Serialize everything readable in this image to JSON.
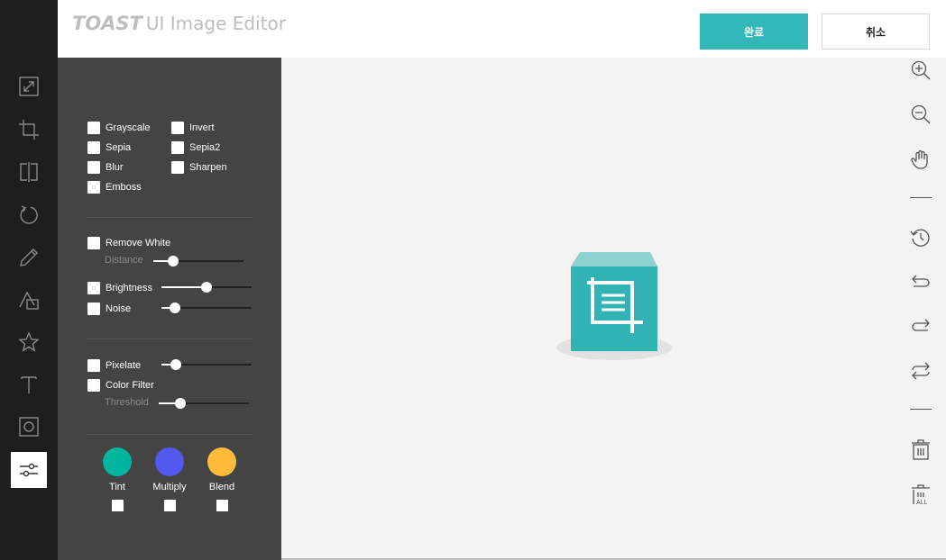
{
  "header": {
    "logo_mark": "TOAST",
    "logo_text": "UI Image Editor",
    "done_label": "완료",
    "cancel_label": "취소"
  },
  "left_toolbar": [
    {
      "name": "resize-icon",
      "active": false
    },
    {
      "name": "crop-icon",
      "active": false
    },
    {
      "name": "flip-icon",
      "active": false
    },
    {
      "name": "rotate-icon",
      "active": false
    },
    {
      "name": "draw-icon",
      "active": false
    },
    {
      "name": "shape-icon",
      "active": false
    },
    {
      "name": "star-icon",
      "active": false
    },
    {
      "name": "text-icon",
      "active": false
    },
    {
      "name": "mask-icon",
      "active": false
    },
    {
      "name": "filter-icon",
      "active": true
    }
  ],
  "filters": {
    "basic": {
      "grayscale": "Grayscale",
      "invert": "Invert",
      "sepia": "Sepia",
      "sepia2": "Sepia2",
      "blur": "Blur",
      "sharpen": "Sharpen",
      "emboss": "Emboss"
    },
    "remove_white": {
      "label": "Remove White",
      "distance_label": "Distance",
      "distance_value": 0.22
    },
    "brightness": {
      "label": "Brightness",
      "value": 0.5
    },
    "noise": {
      "label": "Noise",
      "value": 0.15
    },
    "pixelate": {
      "label": "Pixelate",
      "value": 0.16
    },
    "color_filter": {
      "label": "Color Filter",
      "threshold_label": "Threshold",
      "threshold_value": 0.24
    },
    "colors": [
      {
        "label": "Tint",
        "color": "#00b59e"
      },
      {
        "label": "Multiply",
        "color": "#5159ee"
      },
      {
        "label": "Blend",
        "color": "#ffbb3b"
      }
    ]
  },
  "right_toolbar": [
    "zoom-in-icon",
    "zoom-out-icon",
    "hand-icon",
    "history-icon",
    "undo-icon",
    "redo-icon",
    "reset-icon",
    "delete-icon",
    "delete-all-icon"
  ],
  "colors": {
    "accent": "#32b8b8",
    "panel": "#444444",
    "sidebar": "#1e1e1e"
  }
}
